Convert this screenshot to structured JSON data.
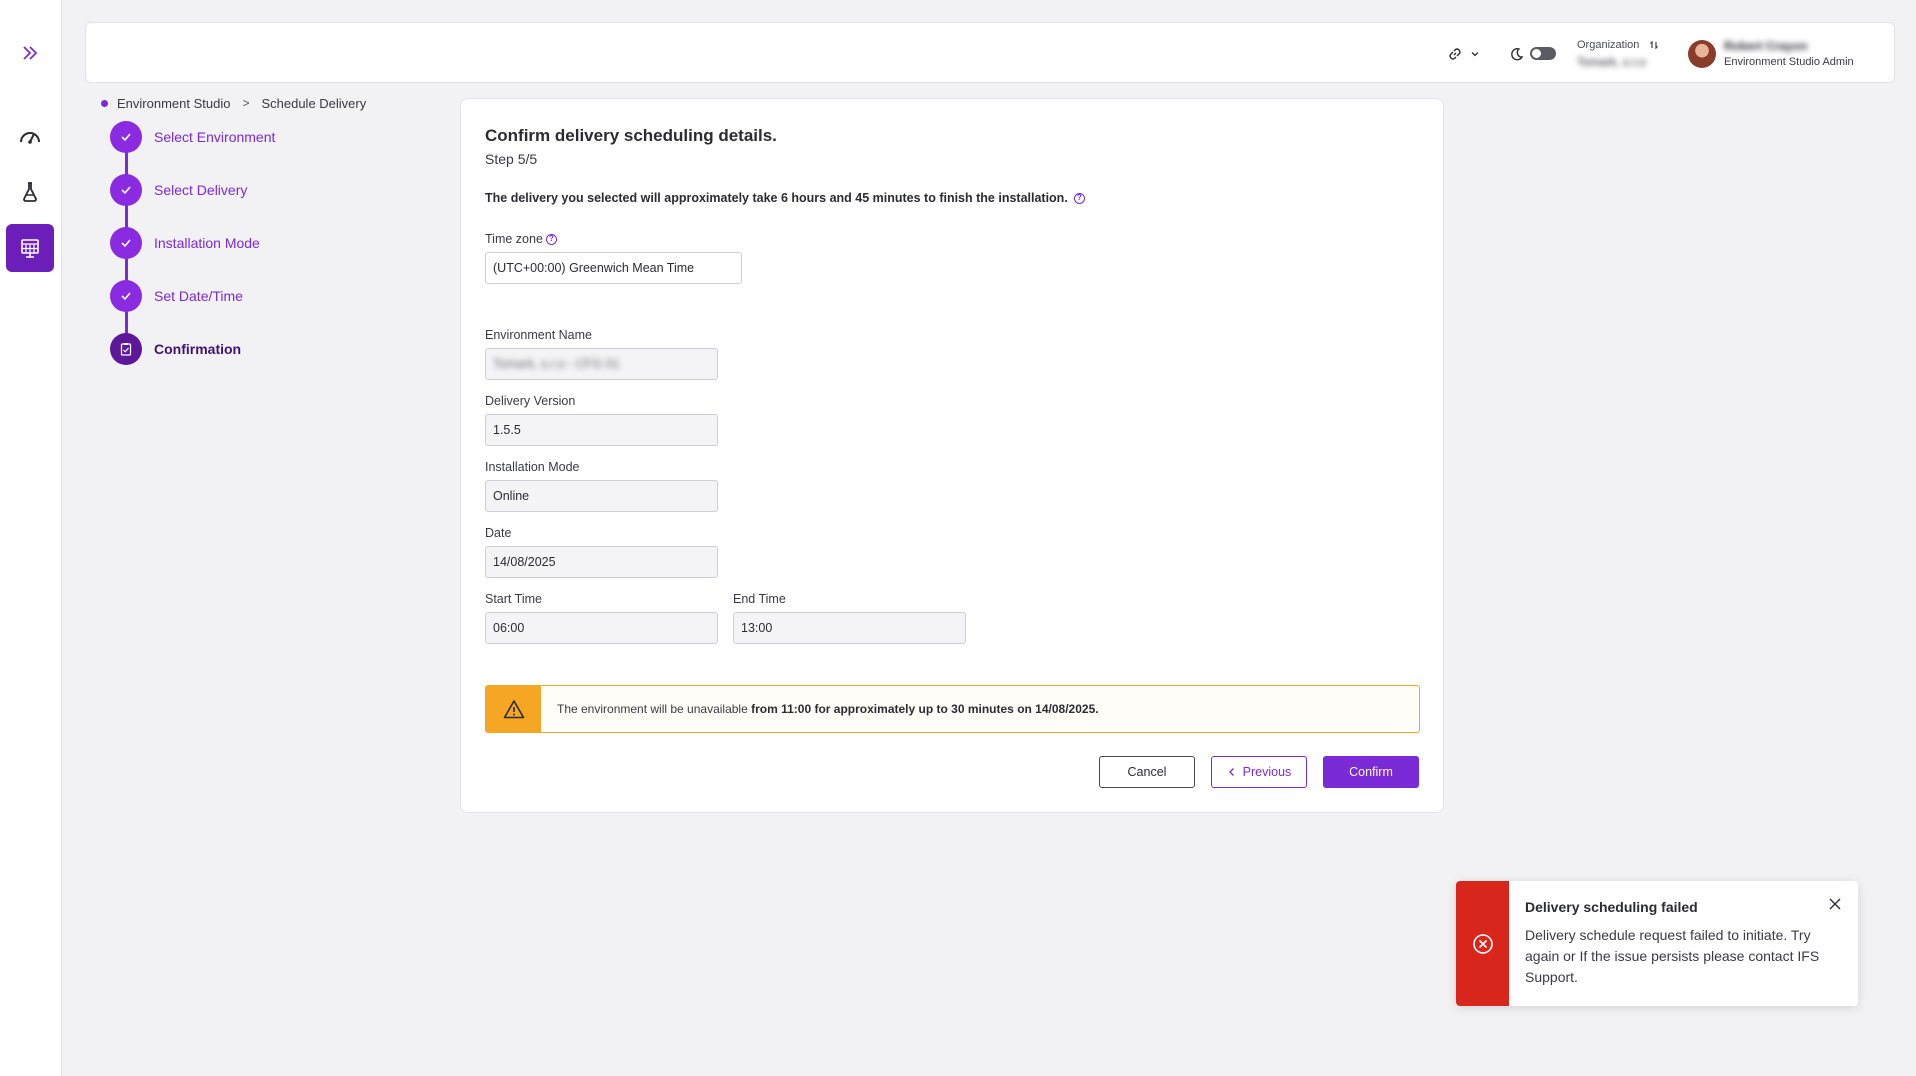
{
  "breadcrumb": {
    "items": [
      "Environment Studio",
      "Schedule Delivery"
    ],
    "separator": ">"
  },
  "topbar": {
    "organization_label": "Organization",
    "organization_value": "Tomark, s.r.o",
    "user_name": "Robert Crayon",
    "user_role": "Environment Studio Admin"
  },
  "stepper": {
    "steps": [
      {
        "label": "Select Environment",
        "status": "done"
      },
      {
        "label": "Select Delivery",
        "status": "done"
      },
      {
        "label": "Installation Mode",
        "status": "done"
      },
      {
        "label": "Set Date/Time",
        "status": "done"
      },
      {
        "label": "Confirmation",
        "status": "current"
      }
    ]
  },
  "card": {
    "title": "Confirm delivery scheduling details.",
    "step": "Step 5/5",
    "info": "The delivery you selected will approximately take 6 hours and 45 minutes to finish the installation."
  },
  "form": {
    "timezone_label": "Time zone",
    "timezone_value": "(UTC+00:00) Greenwich Mean Time",
    "environment_name_label": "Environment Name",
    "environment_name_value": "Tomark, s.r.o - CFG 01",
    "delivery_version_label": "Delivery Version",
    "delivery_version_value": "1.5.5",
    "installation_mode_label": "Installation Mode",
    "installation_mode_value": "Online",
    "date_label": "Date",
    "date_value": "14/08/2025",
    "start_time_label": "Start Time",
    "start_time_value": "06:00",
    "end_time_label": "End Time",
    "end_time_value": "13:00"
  },
  "warning": {
    "prefix": "The environment will be unavailable ",
    "bold": "from 11:00 for approximately up to 30 minutes ",
    "suffix": " on 14/08/2025."
  },
  "buttons": {
    "cancel": "Cancel",
    "previous": "Previous",
    "confirm": "Confirm"
  },
  "toast": {
    "title": "Delivery scheduling failed",
    "message": "Delivery schedule request failed to initiate. Try again or If the issue persists please contact IFS Support."
  },
  "colors": {
    "accent": "#7a2ad6",
    "accent_dark": "#5d1799",
    "warning": "#f5a623",
    "error": "#d9261c"
  }
}
